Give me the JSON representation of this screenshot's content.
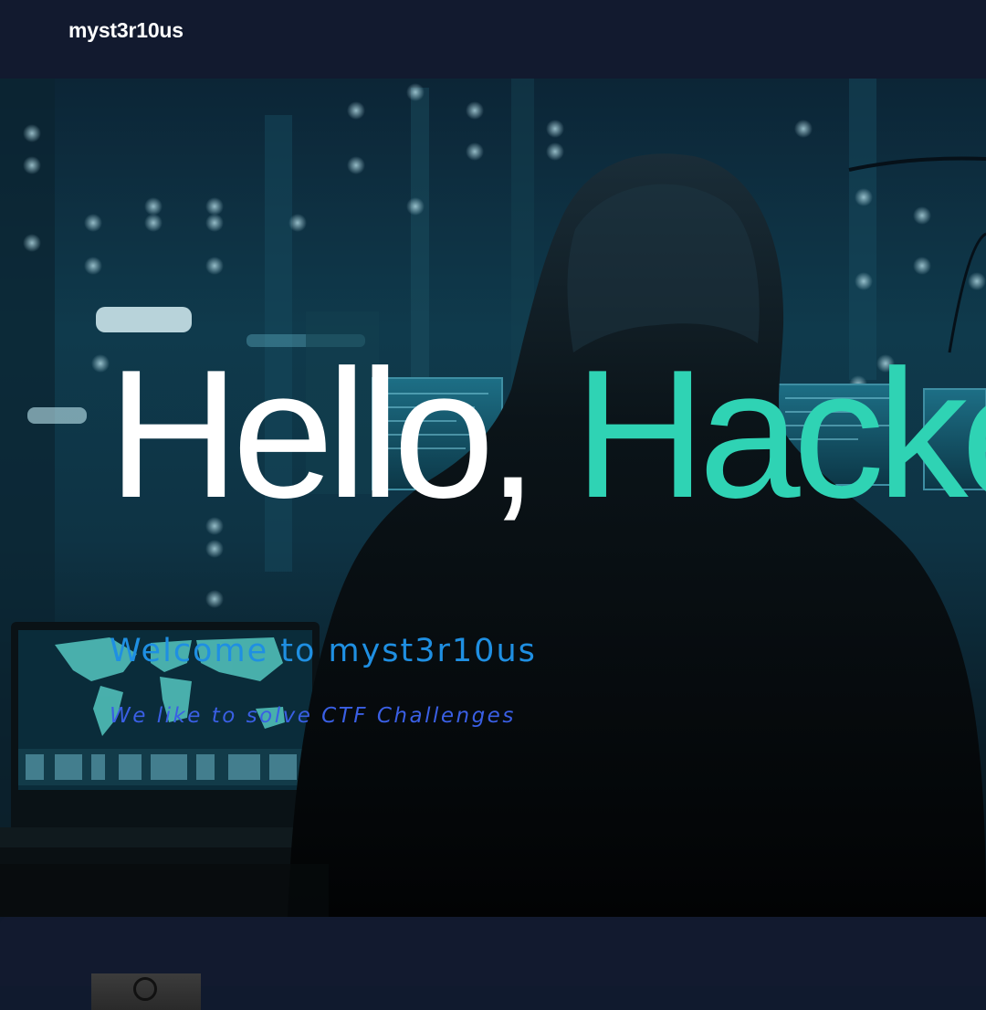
{
  "navbar": {
    "brand": "myst3r10us"
  },
  "hero": {
    "title_prefix": "Hello, ",
    "title_accent": "Hacker",
    "subtitle": "Welcome to myst3r10us",
    "tagline": "We like to solve CTF Challenges",
    "background_image": "hooded-hacker-at-computer-screens",
    "accent_color": "#2fd3b4",
    "subtitle_color": "#1f8fe2",
    "tagline_color": "#3a5fe4"
  },
  "next_section": {
    "avatar": "profile-image"
  }
}
